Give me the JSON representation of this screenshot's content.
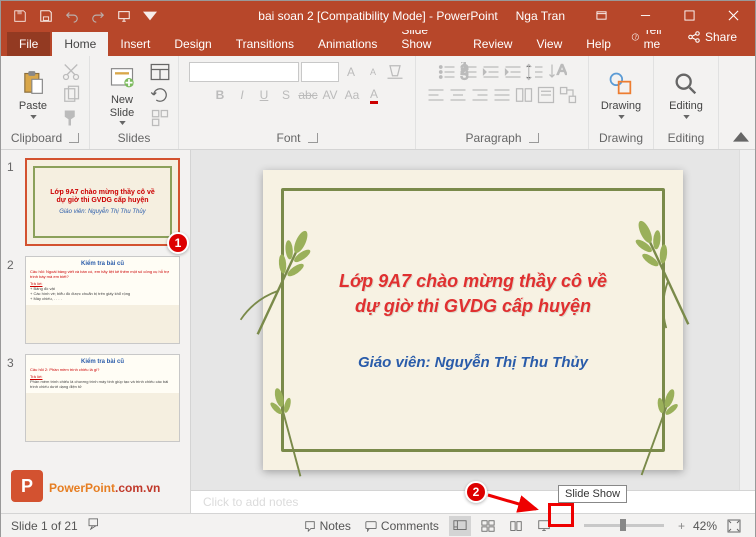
{
  "titlebar": {
    "title": "bai soan 2 [Compatibility Mode] - PowerPoint",
    "user": "Nga Tran"
  },
  "tabs": {
    "file": "File",
    "home": "Home",
    "insert": "Insert",
    "design": "Design",
    "transitions": "Transitions",
    "animations": "Animations",
    "slideshow": "Slide Show",
    "review": "Review",
    "view": "View",
    "help": "Help",
    "tellme": "Tell me",
    "share": "Share"
  },
  "ribbon": {
    "clipboard": {
      "label": "Clipboard",
      "paste": "Paste"
    },
    "slides": {
      "label": "Slides",
      "new_slide": "New\nSlide"
    },
    "font": {
      "label": "Font"
    },
    "paragraph": {
      "label": "Paragraph"
    },
    "drawing": {
      "label": "Drawing",
      "btn": "Drawing"
    },
    "editing": {
      "label": "Editing",
      "btn": "Editing"
    },
    "bold": "B",
    "italic": "I",
    "underline": "U",
    "strike": "S"
  },
  "thumbs": {
    "n1": "1",
    "n2": "2",
    "n3": "3",
    "slide1_title": "Lớp 9A7 chào mừng thầy cô về\ndự giờ thi GVDG cấp huyện",
    "slide1_sub": "Giáo viên: Nguyễn Thị Thu Thủy",
    "slide2_title": "Kiểm tra bài cũ",
    "slide3_title": "Kiểm tra bài cũ"
  },
  "slide": {
    "line1": "Lớp 9A7 chào mừng thầy cô về",
    "line2": "dự giờ thi GVDG cấp huyện",
    "teacher": "Giáo viên: Nguyễn Thị Thu Thủy"
  },
  "notes": {
    "placeholder": "Click to add notes"
  },
  "callouts": {
    "c1": "1",
    "c2": "2"
  },
  "tooltip": {
    "slideshow": "Slide Show"
  },
  "status": {
    "slide_counter": "Slide 1 of 21",
    "lang": "",
    "notes": "Notes",
    "comments": "Comments",
    "zoom": "42%"
  },
  "watermark": {
    "text1": "PowerPoint",
    "text2": ".com.vn",
    "icon": "P"
  }
}
